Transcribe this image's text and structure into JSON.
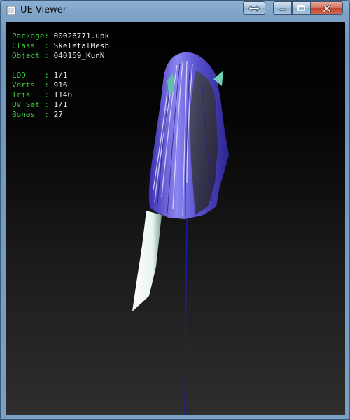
{
  "window": {
    "title": "UE Viewer",
    "controls": {
      "swap": "swap-icon",
      "minimize": "minimize-icon",
      "maximize": "maximize-icon",
      "close": "close-icon"
    }
  },
  "info": {
    "package_label": "Package: ",
    "package_value": "00026771.upk",
    "class_label": "Class  : ",
    "class_value": "SkeletalMesh",
    "object_label": "Object : ",
    "object_value": "040159_KunN",
    "lod_label": "LOD    : ",
    "lod_value": "1/1",
    "verts_label": "Verts  : ",
    "verts_value": "916",
    "tris_label": "Tris   : ",
    "tris_value": "1146",
    "uvset_label": "UV Set : ",
    "uvset_value": "1/1",
    "bones_label": "Bones  : ",
    "bones_value": "27"
  },
  "colors": {
    "label": "#3ec83e",
    "value": "#e8e8e8",
    "hair": "#5b4fd0",
    "bone": "#1a1aa8"
  }
}
